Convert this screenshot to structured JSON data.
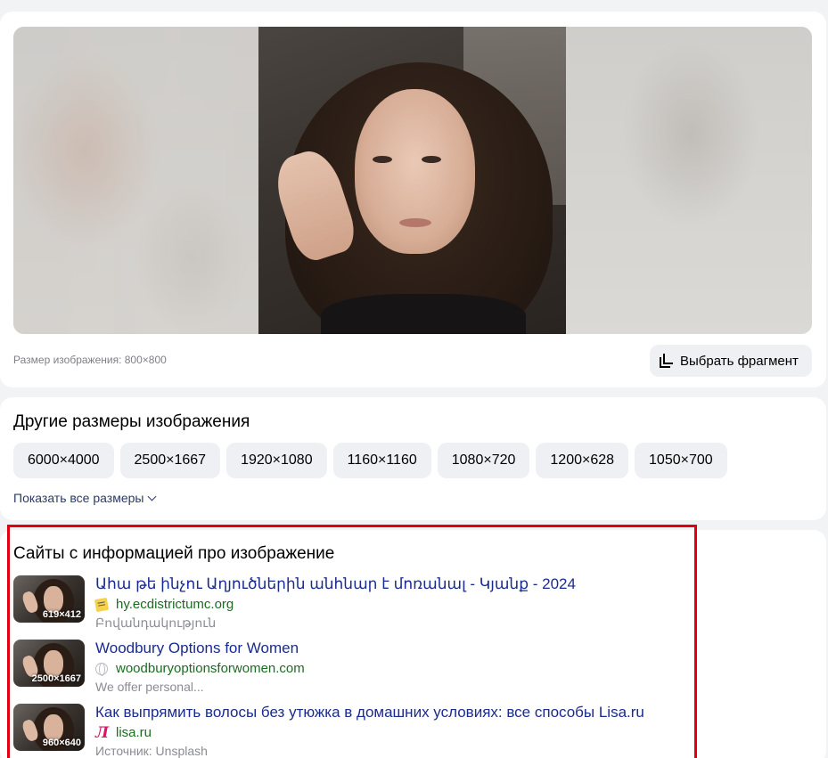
{
  "preview": {
    "image_size_caption": "Размер изображения: 800×800",
    "crop_button_label": "Выбрать фрагмент"
  },
  "other_sizes": {
    "title": "Другие размеры изображения",
    "sizes": [
      "6000×4000",
      "2500×1667",
      "1920×1080",
      "1160×1160",
      "1080×720",
      "1200×628",
      "1050×700"
    ],
    "show_all_label": "Показать все размеры"
  },
  "sites": {
    "title": "Сайты с информацией про изображение",
    "items": [
      {
        "thumb_size": "619×412",
        "title": "Ահա թե ինչու Աղյուծներին անհնար է մոռանալ - Կյանք - 2024",
        "domain": "hy.ecdistrictumc.org",
        "favicon": "note-icon",
        "snippet": "Բովանդակություն"
      },
      {
        "thumb_size": "2500×1667",
        "title": "Woodbury Options for Women",
        "domain": "woodburyoptionsforwomen.com",
        "favicon": "globe-icon",
        "snippet": "We offer personal..."
      },
      {
        "thumb_size": "960×640",
        "title": "Как выпрямить волосы без утюжка в домашних условиях: все способы Lisa.ru",
        "domain": "lisa.ru",
        "favicon": "lisa-logo-icon",
        "favicon_glyph": "Л",
        "snippet": "Источник: Unsplash"
      }
    ]
  },
  "colors": {
    "link": "#1a2b8f",
    "domain": "#1d6b22",
    "highlight": "#e0000f"
  }
}
